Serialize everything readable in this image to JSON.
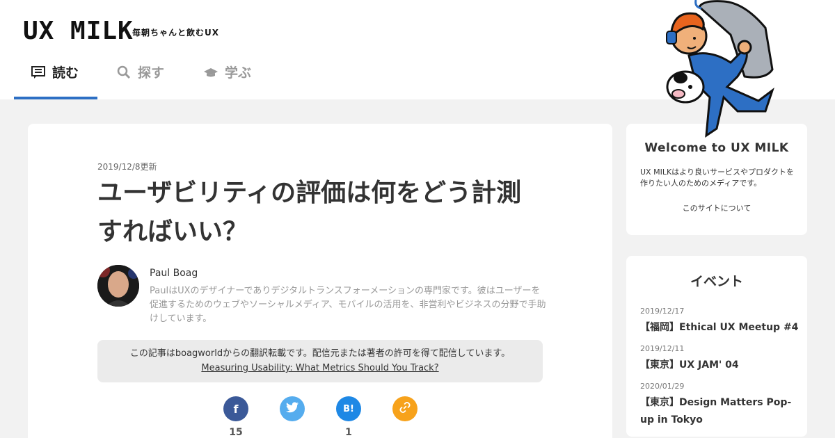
{
  "header": {
    "logo": "UX MILK",
    "tagline": "毎朝ちゃんと飲むUX",
    "nav": [
      {
        "label": "読む"
      },
      {
        "label": "探す"
      },
      {
        "label": "学ぶ"
      }
    ]
  },
  "article": {
    "updated": "2019/12/8更新",
    "title": "ユーザビリティの評価は何をどう計測すればいい？",
    "author": {
      "name": "Paul Boag",
      "bio": "PaulはUXのデザイナーでありデジタルトランスフォーメーションの専門家です。彼はユーザーを促進するためのウェブやソーシャルメディア、モバイルの活用を、非営利やビジネスの分野で手助けしています。"
    },
    "notice": {
      "text": "この記事はboagworldからの翻訳転載です。配信元または著者の許可を得て配信しています。",
      "link": "Measuring Usability: What Metrics Should You Track?"
    },
    "share": {
      "facebook_icon": "f",
      "hatena_icon": "B!",
      "facebook_count": "15",
      "hatena_count": "1"
    }
  },
  "sidebar": {
    "welcome": {
      "title": "Welcome to UX MILK",
      "text": "UX MILKはより良いサービスやプロダクトを作りたい人のためのメディアです。",
      "link": "このサイトについて"
    },
    "events": {
      "title": "イベント",
      "items": [
        {
          "date": "2019/12/17",
          "name": "【福岡】Ethical UX Meetup #4"
        },
        {
          "date": "2019/12/11",
          "name": "【東京】UX JAM' 04"
        },
        {
          "date": "2020/01/29",
          "name": "【東京】Design Matters Pop-up in Tokyo"
        }
      ]
    }
  },
  "colors": {
    "accent": "#2d6fc4",
    "facebook": "#3b5998",
    "twitter": "#55acee",
    "hatena": "#1e88e5",
    "link": "#f7a21b"
  }
}
